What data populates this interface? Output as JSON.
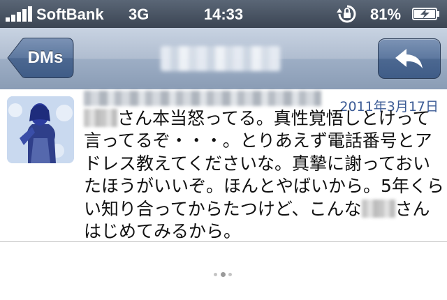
{
  "status_bar": {
    "carrier": "SoftBank",
    "network": "3G",
    "time": "14:33",
    "battery_percent": "81%",
    "signal_icon": "signal-bars-icon",
    "lock_icon": "rotation-lock-icon",
    "battery_icon": "battery-charging-icon"
  },
  "nav": {
    "back_label": "DMs",
    "reply_icon": "reply-arrow-icon",
    "accent": "#8a9cb5"
  },
  "message": {
    "date": "2011年3月17日",
    "lines": [
      {
        "pre": "",
        "redacted": true,
        "post": "さん本当怒ってる。真性覚悟しとけって"
      },
      {
        "pre": "言ってるぞ・・・。とりあえず電話番号とア",
        "redacted": false,
        "post": ""
      },
      {
        "pre": "ドレス教えてくださいな。真摯に謝っておい",
        "redacted": false,
        "post": ""
      },
      {
        "pre": "たほうがいいぞ。ほんとやばいから。5年くら",
        "redacted": false,
        "post": ""
      },
      {
        "pre": "い知り合ってからたつけど、こんな",
        "redacted": true,
        "post": "さん"
      },
      {
        "pre": "はじめてみるから。",
        "redacted": false,
        "post": ""
      }
    ],
    "timestamp_color": "#3b5b95"
  },
  "footer": {
    "spinner_icon": "loading-dots-icon"
  }
}
